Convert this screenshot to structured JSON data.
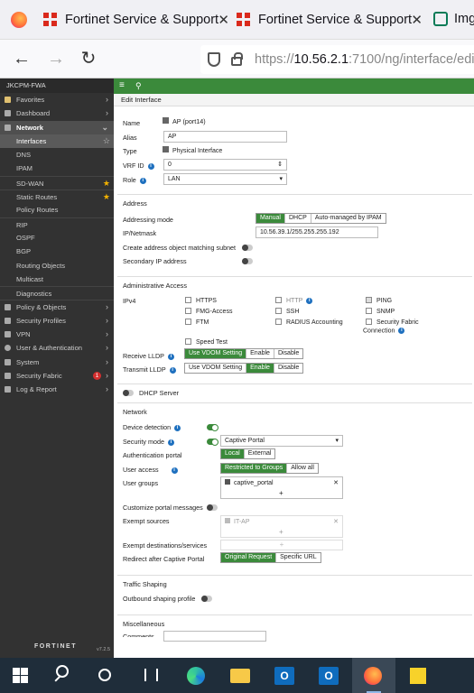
{
  "browser": {
    "tabs": [
      {
        "title": "Fortinet Service & Support",
        "close": "✕"
      },
      {
        "title": "Fortinet Service & Support",
        "close": "✕"
      },
      {
        "title": "Imgu"
      }
    ],
    "url_prefix": "https://",
    "url_host": "10.56.2.1",
    "url_rest": ":7100/ng/interface/edit"
  },
  "sidebar": {
    "device": "JKCPM-FWA",
    "items": [
      {
        "label": "Favorites"
      },
      {
        "label": "Dashboard"
      },
      {
        "label": "Network"
      },
      {
        "label": "Interfaces"
      },
      {
        "label": "DNS"
      },
      {
        "label": "IPAM"
      },
      {
        "label": "SD-WAN"
      },
      {
        "label": "Static Routes"
      },
      {
        "label": "Policy Routes"
      },
      {
        "label": "RIP"
      },
      {
        "label": "OSPF"
      },
      {
        "label": "BGP"
      },
      {
        "label": "Routing Objects"
      },
      {
        "label": "Multicast"
      },
      {
        "label": "Diagnostics"
      },
      {
        "label": "Policy & Objects"
      },
      {
        "label": "Security Profiles"
      },
      {
        "label": "VPN"
      },
      {
        "label": "User & Authentication"
      },
      {
        "label": "System"
      },
      {
        "label": "Security Fabric",
        "badge": "1"
      },
      {
        "label": "Log & Report"
      }
    ],
    "brand": "FORTINET",
    "version": "v7.2.5"
  },
  "main": {
    "title": "Edit Interface",
    "name_label": "Name",
    "name_value": "AP (port14)",
    "alias_label": "Alias",
    "alias_value": "AP",
    "type_label": "Type",
    "type_value": "Physical Interface",
    "vrf_label": "VRF ID",
    "vrf_value": "0",
    "role_label": "Role",
    "role_value": "LAN",
    "address": {
      "heading": "Address",
      "mode_label": "Addressing mode",
      "modes": [
        "Manual",
        "DHCP",
        "Auto-managed by IPAM"
      ],
      "ip_label": "IP/Netmask",
      "ip_value": "10.56.39.1/255.255.255.192",
      "create_obj_label": "Create address object matching subnet",
      "secondary_label": "Secondary IP address"
    },
    "admin": {
      "heading": "Administrative Access",
      "ipv4_label": "IPv4",
      "https": "HTTPS",
      "http": "HTTP",
      "ping": "PING",
      "fmg": "FMG-Access",
      "ssh": "SSH",
      "snmp": "SNMP",
      "ftm": "FTM",
      "radius": "RADIUS Accounting",
      "fabric1": "Security Fabric",
      "fabric2": "Connection",
      "speed": "Speed Test",
      "rx_lldp": "Receive LLDP",
      "tx_lldp": "Transmit LLDP",
      "lldp_opts": [
        "Use VDOM Setting",
        "Enable",
        "Disable"
      ]
    },
    "dhcp_label": "DHCP Server",
    "network": {
      "heading": "Network",
      "detect_label": "Device detection",
      "secmode_label": "Security mode",
      "secmode_value": "Captive Portal",
      "authportal_label": "Authentication portal",
      "authportal_opts": [
        "Local",
        "External"
      ],
      "useraccess_label": "User access",
      "useraccess_opts": [
        "Restricted to Groups",
        "Allow all"
      ],
      "usergroups_label": "User groups",
      "usergroup_value": "captive_portal",
      "plus": "+",
      "remove": "✕",
      "customize_label": "Customize portal messages",
      "exempt_src_label": "Exempt sources",
      "exempt_src_value": "IT-AP",
      "exempt_dst_label": "Exempt destinations/services",
      "redirect_label": "Redirect after Captive Portal",
      "redirect_opts": [
        "Original Request",
        "Specific URL"
      ]
    },
    "traffic": {
      "heading": "Traffic Shaping",
      "outbound_label": "Outbound shaping profile"
    },
    "misc": {
      "heading": "Miscellaneous",
      "comments": "Comments"
    }
  }
}
